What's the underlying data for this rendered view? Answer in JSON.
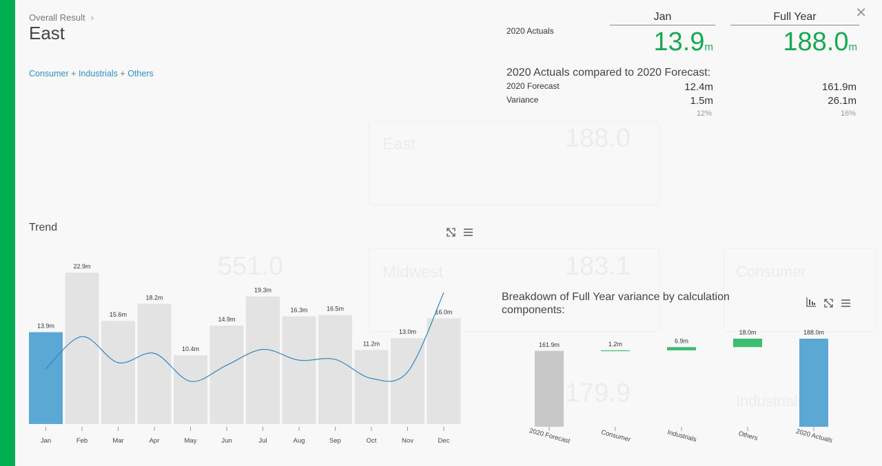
{
  "header": {
    "breadcrumb": "Overall Result",
    "title": "East",
    "filter": {
      "links": [
        "Consumer",
        "Industrials",
        "Others"
      ],
      "separator": "+"
    }
  },
  "kpi": {
    "row_label": "2020 Actuals",
    "columns": [
      {
        "head": "Jan",
        "value": "13.9",
        "unit": "m",
        "forecast": "12.4m",
        "variance": "1.5m",
        "variance_pct": "12%"
      },
      {
        "head": "Full Year",
        "value": "188.0",
        "unit": "m",
        "forecast": "161.9m",
        "variance": "26.1m",
        "variance_pct": "16%"
      }
    ],
    "compare_title": "2020 Actuals compared to 2020 Forecast:",
    "forecast_label": "2020 Forecast",
    "variance_label": "Variance",
    "accent_color": "#17a853"
  },
  "trend": {
    "title": "Trend",
    "icons": [
      "expand-icon",
      "menu-icon"
    ]
  },
  "breakdown": {
    "title_line1": "Breakdown of Full Year variance by calculation",
    "title_line2": "components:",
    "icons": [
      "waterfall-icon",
      "expand-icon",
      "menu-icon"
    ]
  },
  "background": {
    "texts": [
      "East",
      "188.0",
      "Midwest",
      "183.1",
      "551.0",
      "179.9",
      "Consumer",
      "Industrials"
    ]
  },
  "chart_data": [
    {
      "type": "bar",
      "title": "Trend",
      "categories": [
        "Jan",
        "Feb",
        "Mar",
        "Apr",
        "May",
        "Jun",
        "Jul",
        "Aug",
        "Sep",
        "Oct",
        "Nov",
        "Dec"
      ],
      "values": [
        13.9,
        22.9,
        15.6,
        18.2,
        10.4,
        14.9,
        19.3,
        16.3,
        16.5,
        11.2,
        13.0,
        16.0
      ],
      "value_labels": [
        "13.9m",
        "22.9m",
        "15.6m",
        "18.2m",
        "10.4m",
        "14.9m",
        "19.3m",
        "16.3m",
        "16.5m",
        "11.2m",
        "13.0m",
        "16.0m"
      ],
      "highlight_index": 0,
      "colors": {
        "highlight": "#5ba8d5",
        "bar": "#e3e3e3",
        "line": "#2f86bd"
      },
      "ylim": [
        0,
        25
      ],
      "smoothed_line": true
    },
    {
      "type": "bar",
      "subtype": "waterfall",
      "title": "Breakdown of Full Year variance by calculation components:",
      "categories": [
        "2020 Forecast",
        "Consumer",
        "Industrials",
        "Others",
        "2020 Actuals"
      ],
      "values": [
        161.9,
        1.2,
        6.9,
        18.0,
        188.0
      ],
      "value_labels": [
        "161.9m",
        "1.2m",
        "6.9m",
        "18.0m",
        "188.0m"
      ],
      "kinds": [
        "total",
        "delta",
        "delta",
        "delta",
        "total"
      ],
      "colors": {
        "forecast": "#c8c8c8",
        "delta": "#3dbd6e",
        "actual": "#5ba8d5"
      }
    }
  ]
}
